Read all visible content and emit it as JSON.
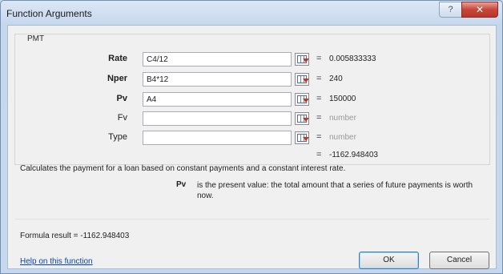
{
  "window": {
    "title": "Function Arguments",
    "help_glyph": "?",
    "close_glyph": "✕"
  },
  "function_name": "PMT",
  "arguments": [
    {
      "label": "Rate",
      "required": true,
      "value": "C4/12",
      "result": "0.005833333"
    },
    {
      "label": "Nper",
      "required": true,
      "value": "B4*12",
      "result": "240"
    },
    {
      "label": "Pv",
      "required": true,
      "value": "A4",
      "result": "150000"
    },
    {
      "label": "Fv",
      "required": false,
      "value": "",
      "result": "number"
    },
    {
      "label": "Type",
      "required": false,
      "value": "",
      "result": "number"
    }
  ],
  "equals_sign": "=",
  "function_result": "-1162.948403",
  "description": "Calculates the payment for a loan based on constant payments and a constant interest rate.",
  "arg_help": {
    "name": "Pv",
    "text": "is the present value: the total amount that a series of future payments is worth now."
  },
  "formula_result": {
    "label": "Formula result =",
    "value": "-1162.948403"
  },
  "help_link": "Help on this function",
  "buttons": {
    "ok": "OK",
    "cancel": "Cancel"
  }
}
